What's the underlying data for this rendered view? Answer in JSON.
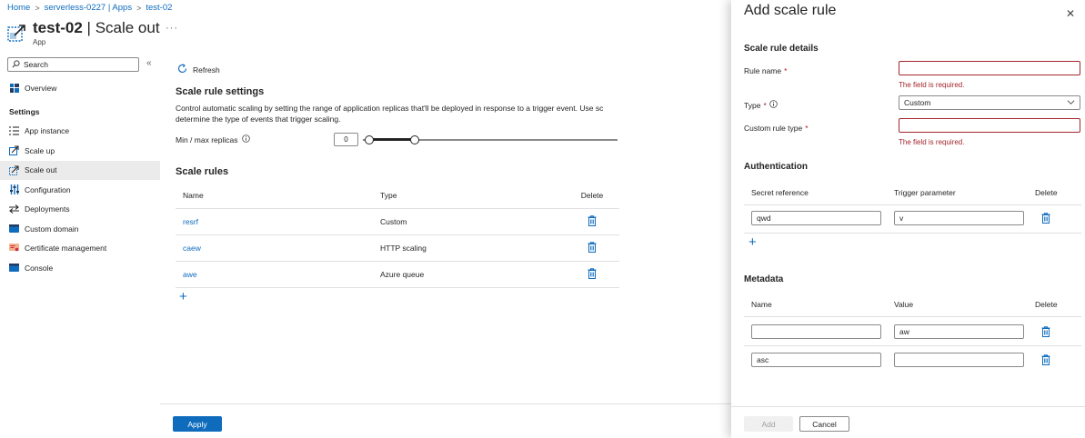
{
  "breadcrumb": [
    "Home",
    "serverless-0227 | Apps",
    "test-02"
  ],
  "header": {
    "name": "test-02",
    "section": "Scale out",
    "type": "App",
    "more": "···"
  },
  "search": {
    "placeholder": "Search"
  },
  "nav": {
    "overview": "Overview",
    "settings_section": "Settings",
    "items": [
      "App instance",
      "Scale up",
      "Scale out",
      "Configuration",
      "Deployments",
      "Custom domain",
      "Certificate management",
      "Console"
    ],
    "active": "Scale out"
  },
  "main": {
    "refresh": "Refresh",
    "settings_title": "Scale rule settings",
    "description_1": "Control automatic scaling by setting the range of application replicas that'll be deployed in response to a trigger event. Use sc",
    "description_2": "determine the type of events that trigger scaling.",
    "replicas_label": "Min / max replicas",
    "min_replicas": "0",
    "rules_title": "Scale rules",
    "columns": [
      "Name",
      "Type",
      "Delete"
    ],
    "rules": [
      {
        "name": "resrf",
        "type": "Custom"
      },
      {
        "name": "caew",
        "type": "HTTP scaling"
      },
      {
        "name": "awe",
        "type": "Azure queue"
      }
    ],
    "apply": "Apply"
  },
  "panel": {
    "title": "Add scale rule",
    "details_title": "Scale rule details",
    "rule_name_label": "Rule name",
    "rule_name_value": "",
    "type_label": "Type",
    "type_value": "Custom",
    "custom_type_label": "Custom rule type",
    "custom_type_value": "",
    "required_error": "The field is required.",
    "auth_title": "Authentication",
    "auth_columns": [
      "Secret reference",
      "Trigger parameter",
      "Delete"
    ],
    "auth_rows": [
      {
        "secret": "qwd",
        "param": "v"
      }
    ],
    "meta_title": "Metadata",
    "meta_columns": [
      "Name",
      "Value",
      "Delete"
    ],
    "meta_rows": [
      {
        "name": "",
        "value": "aw"
      },
      {
        "name": "asc",
        "value": ""
      }
    ],
    "add": "Add",
    "cancel": "Cancel"
  },
  "colors": {
    "accent": "#0f6cbd",
    "error": "#a4262c"
  }
}
